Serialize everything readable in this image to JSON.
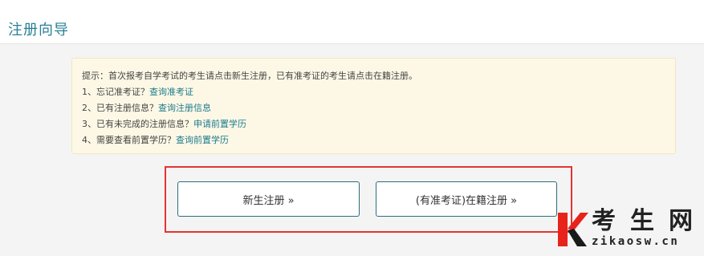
{
  "page": {
    "title": "注册向导"
  },
  "tip": {
    "intro": "提示：首次报考自学考试的考生请点击新生注册，已有准考证的考生请点击在籍注册。",
    "items": [
      {
        "text": "1、忘记准考证？",
        "link": "查询准考证"
      },
      {
        "text": "2、已有注册信息？",
        "link": "查询注册信息"
      },
      {
        "text": "3、已有未完成的注册信息？",
        "link": "申请前置学历"
      },
      {
        "text": "4、需要查看前置学历？",
        "link": "查询前置学历"
      }
    ]
  },
  "buttons": {
    "new_registration": "新生注册 »",
    "existing_registration": "(有准考证)在籍注册 »"
  },
  "watermark": {
    "logo_letter": "K",
    "name": "考生网",
    "domain": "zikaosw.cn"
  },
  "colors": {
    "title": "#2a7f95",
    "link": "#1d7b8c",
    "tip_background": "#fdf8e6",
    "highlight_box": "#e53333",
    "logo_red": "#e8231c"
  }
}
